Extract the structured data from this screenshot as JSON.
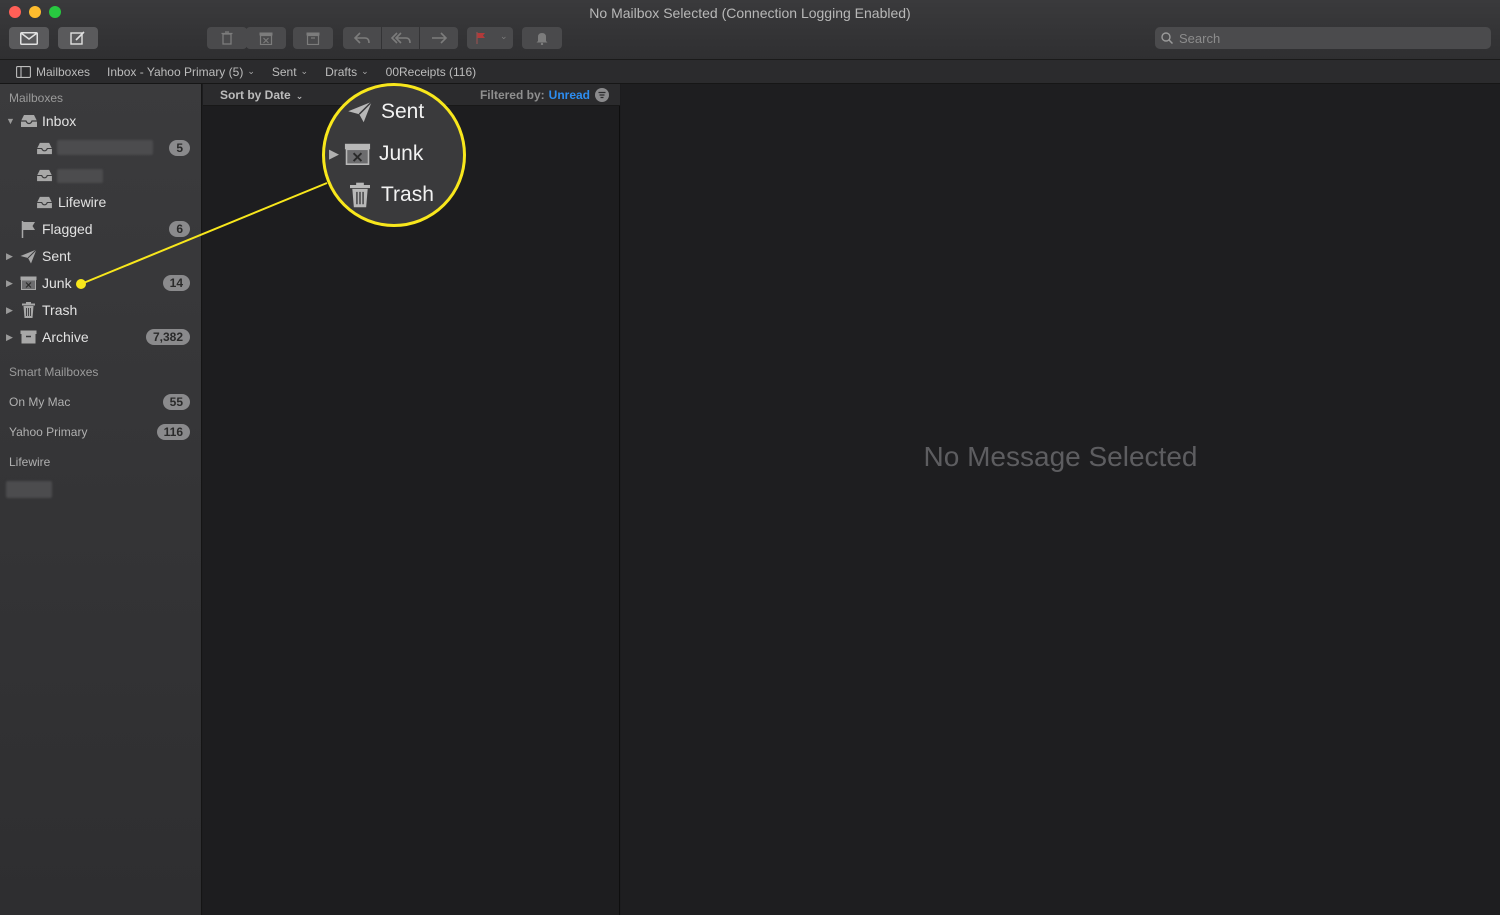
{
  "window": {
    "title": "No Mailbox Selected (Connection Logging Enabled)"
  },
  "toolbar": {
    "icons": [
      "envelope-icon",
      "compose-icon",
      "trash-icon",
      "archive-box-icon",
      "junk-icon",
      "reply-icon",
      "reply-all-icon",
      "forward-icon",
      "flag-icon",
      "bell-icon"
    ],
    "search_placeholder": "Search"
  },
  "favorites": [
    {
      "label": "Mailboxes",
      "chevron": false
    },
    {
      "label": "Inbox - Yahoo Primary (5)",
      "chevron": true
    },
    {
      "label": "Sent",
      "chevron": true
    },
    {
      "label": "Drafts",
      "chevron": true
    },
    {
      "label": "00Receipts (116)",
      "chevron": false
    }
  ],
  "sidebar": {
    "section_mailboxes": "Mailboxes",
    "inbox": {
      "label": "Inbox"
    },
    "inbox_children": [
      {
        "label": "",
        "badge": "5",
        "redacted": true
      },
      {
        "label": "",
        "badge": "",
        "redacted": true
      },
      {
        "label": "Lifewire",
        "badge": ""
      }
    ],
    "items": [
      {
        "label": "Flagged",
        "badge": "6",
        "icon": "flag-icon"
      },
      {
        "label": "Sent",
        "badge": "",
        "icon": "paper-plane-icon"
      },
      {
        "label": "Junk",
        "badge": "14",
        "icon": "junk-box-icon"
      },
      {
        "label": "Trash",
        "badge": "",
        "icon": "trash-icon"
      },
      {
        "label": "Archive",
        "badge": "7,382",
        "icon": "archive-box-icon"
      }
    ],
    "section_smart": "Smart Mailboxes",
    "accounts": [
      {
        "label": "On My Mac",
        "badge": "55"
      },
      {
        "label": "Yahoo Primary",
        "badge": "116"
      },
      {
        "label": "Lifewire",
        "badge": ""
      }
    ]
  },
  "message_list": {
    "sort_label": "Sort by Date",
    "filtered_label": "Filtered by:",
    "filter_value": "Unread"
  },
  "viewer": {
    "empty_text": "No Message Selected"
  },
  "callout": {
    "items": [
      {
        "label": "Sent"
      },
      {
        "label": "Junk"
      },
      {
        "label": "Trash"
      }
    ],
    "accent": "#f8e71c"
  }
}
